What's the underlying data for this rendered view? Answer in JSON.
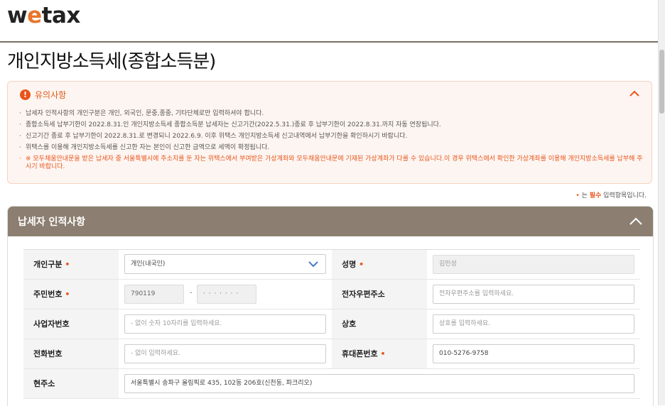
{
  "logo": {
    "pre": "w",
    "accent": "e",
    "post": "tax"
  },
  "page_title": "개인지방소득세(종합소득분)",
  "notice": {
    "title": "유의사항",
    "items": [
      "납세자 인적사항의 개인구분은 개인, 외국인, 문중,종중, 기타단체로만 입력하셔야 합니다.",
      "종합소득세 납부기한이 2022.8.31.인 개인지방소득세 종합소득분 납세자는 신고기간(2022.5.31.)종료 후 납부기한이 2022.8.31.까지 자동 연장됩니다.",
      "신고기간 종료 후 납부기한이 2022.8.31.로 변경되니 2022.6.9. 이후 위택스 개인지방소득세 신고내역에서 납부기한을 확인하시기 바랍니다.",
      "위택스를 이용해 개인지방소득세를 신고한 자는 본인이 신고한 금액으로 세액이 확정됩니다."
    ],
    "warning": "※ 모두채움안내문을 받은 납세자 중 서울특별시에 주소지를 둔 자는 위택스에서 부여받은 가상계좌와 모두채움안내문에 기재된 가상계좌가 다를 수 있습니다.이 경우 위택스에서 확인한 가상계좌를 이용해 개인지방소득세를 납부해 주시기 바랍니다."
  },
  "required_note": {
    "dot": "•",
    "pre": " 는 ",
    "strong": "필수",
    "post": " 입력항목입니다."
  },
  "section": {
    "title": "납세자 인적사항"
  },
  "form": {
    "req_mark": "•",
    "individual_type": {
      "label": "개인구분",
      "value": "개인(내국인)"
    },
    "name": {
      "label": "성명",
      "value": "김민성"
    },
    "rrn": {
      "label": "주민번호",
      "front": "790119",
      "dash": "-",
      "back": "· · · · · · ·"
    },
    "email": {
      "label": "전자우편주소",
      "placeholder": "전자우편주소를 입력하세요."
    },
    "biz_no": {
      "label": "사업자번호",
      "placeholder": "- 없이 숫자 10자리를 입력하세요."
    },
    "company": {
      "label": "상호",
      "placeholder": "상호를 입력하세요."
    },
    "phone": {
      "label": "전화번호",
      "placeholder": "- 없이 입력하세요."
    },
    "mobile": {
      "label": "휴대폰번호",
      "value": "010-5276-9758"
    },
    "address": {
      "label": "현주소",
      "value": "서울특별시 송파구 올림픽로 435, 102동 206호(신천동, 파크리오)"
    }
  },
  "colors": {
    "accent": "#e8541a",
    "section_header": "#8c7f71",
    "notice_bg": "#fdf5f1"
  }
}
